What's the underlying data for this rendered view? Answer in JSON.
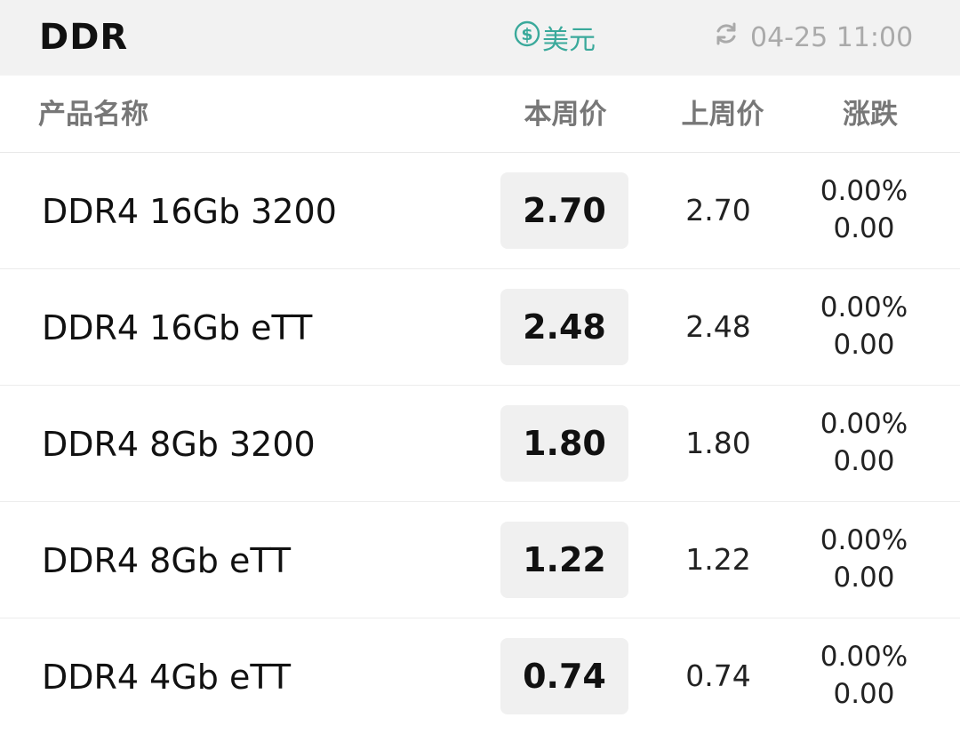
{
  "header": {
    "title": "DDR",
    "currency_label": "美元",
    "currency_icon": "dollar-circle-icon",
    "timestamp": "04-25 11:00",
    "refresh_icon": "refresh-icon"
  },
  "columns": {
    "name": "产品名称",
    "current": "本周价",
    "previous": "上周价",
    "change": "涨跌"
  },
  "rows": [
    {
      "name": "DDR4 16Gb 3200",
      "current": "2.70",
      "previous": "2.70",
      "change_pct": "0.00%",
      "change_abs": "0.00"
    },
    {
      "name": "DDR4 16Gb eTT",
      "current": "2.48",
      "previous": "2.48",
      "change_pct": "0.00%",
      "change_abs": "0.00"
    },
    {
      "name": "DDR4 8Gb 3200",
      "current": "1.80",
      "previous": "1.80",
      "change_pct": "0.00%",
      "change_abs": "0.00"
    },
    {
      "name": "DDR4 8Gb eTT",
      "current": "1.22",
      "previous": "1.22",
      "change_pct": "0.00%",
      "change_abs": "0.00"
    },
    {
      "name": "DDR4 4Gb eTT",
      "current": "0.74",
      "previous": "0.74",
      "change_pct": "0.00%",
      "change_abs": "0.00"
    }
  ],
  "colors": {
    "accent": "#3aa99b",
    "topbar_bg": "#f2f2f2",
    "price_chip_bg": "#f0f0f0",
    "muted_text": "#aaaaaa"
  }
}
